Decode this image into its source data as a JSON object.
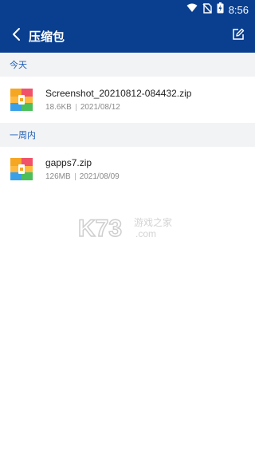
{
  "status_bar": {
    "time": "8:56",
    "icons": [
      "wifi-icon",
      "no-sim-icon",
      "battery-charging-icon"
    ]
  },
  "app_bar": {
    "title": "压缩包",
    "back_icon": "chevron-left-icon",
    "edit_icon": "edit-icon"
  },
  "sections": [
    {
      "header": "今天",
      "files": [
        {
          "name": "Screenshot_20210812-084432.zip",
          "size": "18.6KB",
          "date": "2021/08/12",
          "icon": "zip-archive-icon"
        }
      ]
    },
    {
      "header": "一周内",
      "files": [
        {
          "name": "gapps7.zip",
          "size": "126MB",
          "date": "2021/08/09",
          "icon": "zip-archive-icon"
        }
      ]
    }
  ],
  "watermark": {
    "brand": "K73",
    "text": "游戏之家",
    "domain": ".com"
  },
  "colors": {
    "primary": "#0a3f8f",
    "section_bg": "#f2f3f5",
    "section_text": "#1f5fb8"
  }
}
